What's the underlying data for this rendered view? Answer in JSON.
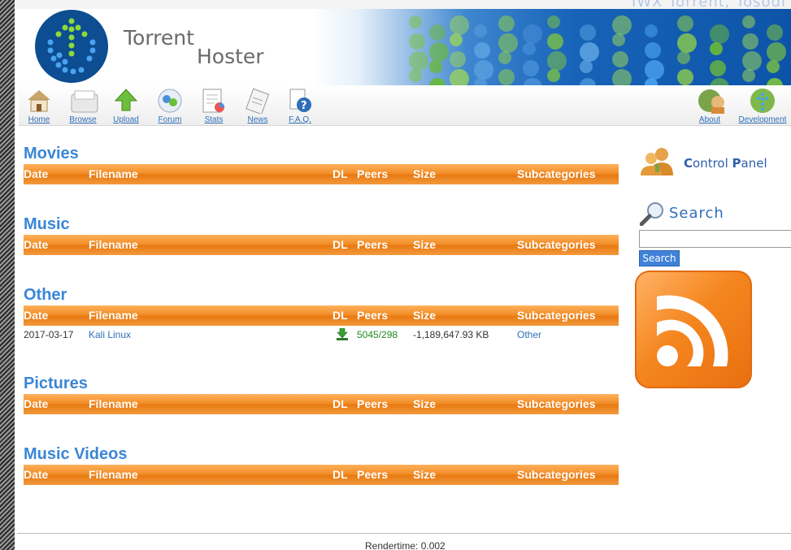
{
  "header": {
    "ghost_text": "IWX Torrent, Tosodi",
    "title_line1": "Torrent",
    "title_line2": "Hoster"
  },
  "nav": {
    "left": [
      {
        "label": "Home",
        "icon": "home-icon"
      },
      {
        "label": "Browse",
        "icon": "browse-icon"
      },
      {
        "label": "Upload",
        "icon": "upload-icon"
      },
      {
        "label": "Forum",
        "icon": "forum-icon"
      },
      {
        "label": "Stats",
        "icon": "stats-icon"
      },
      {
        "label": "News",
        "icon": "news-icon"
      },
      {
        "label": "F.A.Q.",
        "icon": "faq-icon"
      }
    ],
    "right": [
      {
        "label": "About",
        "icon": "about-icon"
      },
      {
        "label": "Development",
        "icon": "development-icon"
      }
    ]
  },
  "columns": {
    "date": "Date",
    "filename": "Filename",
    "dl": "DL",
    "peers": "Peers",
    "size": "Size",
    "subcategories": "Subcategories"
  },
  "categories": [
    {
      "title": "Movies",
      "rows": []
    },
    {
      "title": "Music",
      "rows": []
    },
    {
      "title": "Other",
      "rows": [
        {
          "date": "2017-03-17",
          "filename": "Kali Linux",
          "peers": "5045/298",
          "size": "-1,189,647.93 KB",
          "subcategory": "Other"
        }
      ]
    },
    {
      "title": "Pictures",
      "rows": []
    },
    {
      "title": "Music Videos",
      "rows": []
    }
  ],
  "sidebar": {
    "control_panel_prefix1": "C",
    "control_panel_rest1": "ontrol ",
    "control_panel_prefix2": "P",
    "control_panel_rest2": "anel",
    "search_title": "Search",
    "search_value": "",
    "search_button": "Search"
  },
  "footer": {
    "rendertime": "Rendertime: 0.002"
  },
  "colors": {
    "accent_blue": "#3a86d6",
    "header_orange": "#f08a23",
    "peers_green": "#1f8a1f"
  }
}
